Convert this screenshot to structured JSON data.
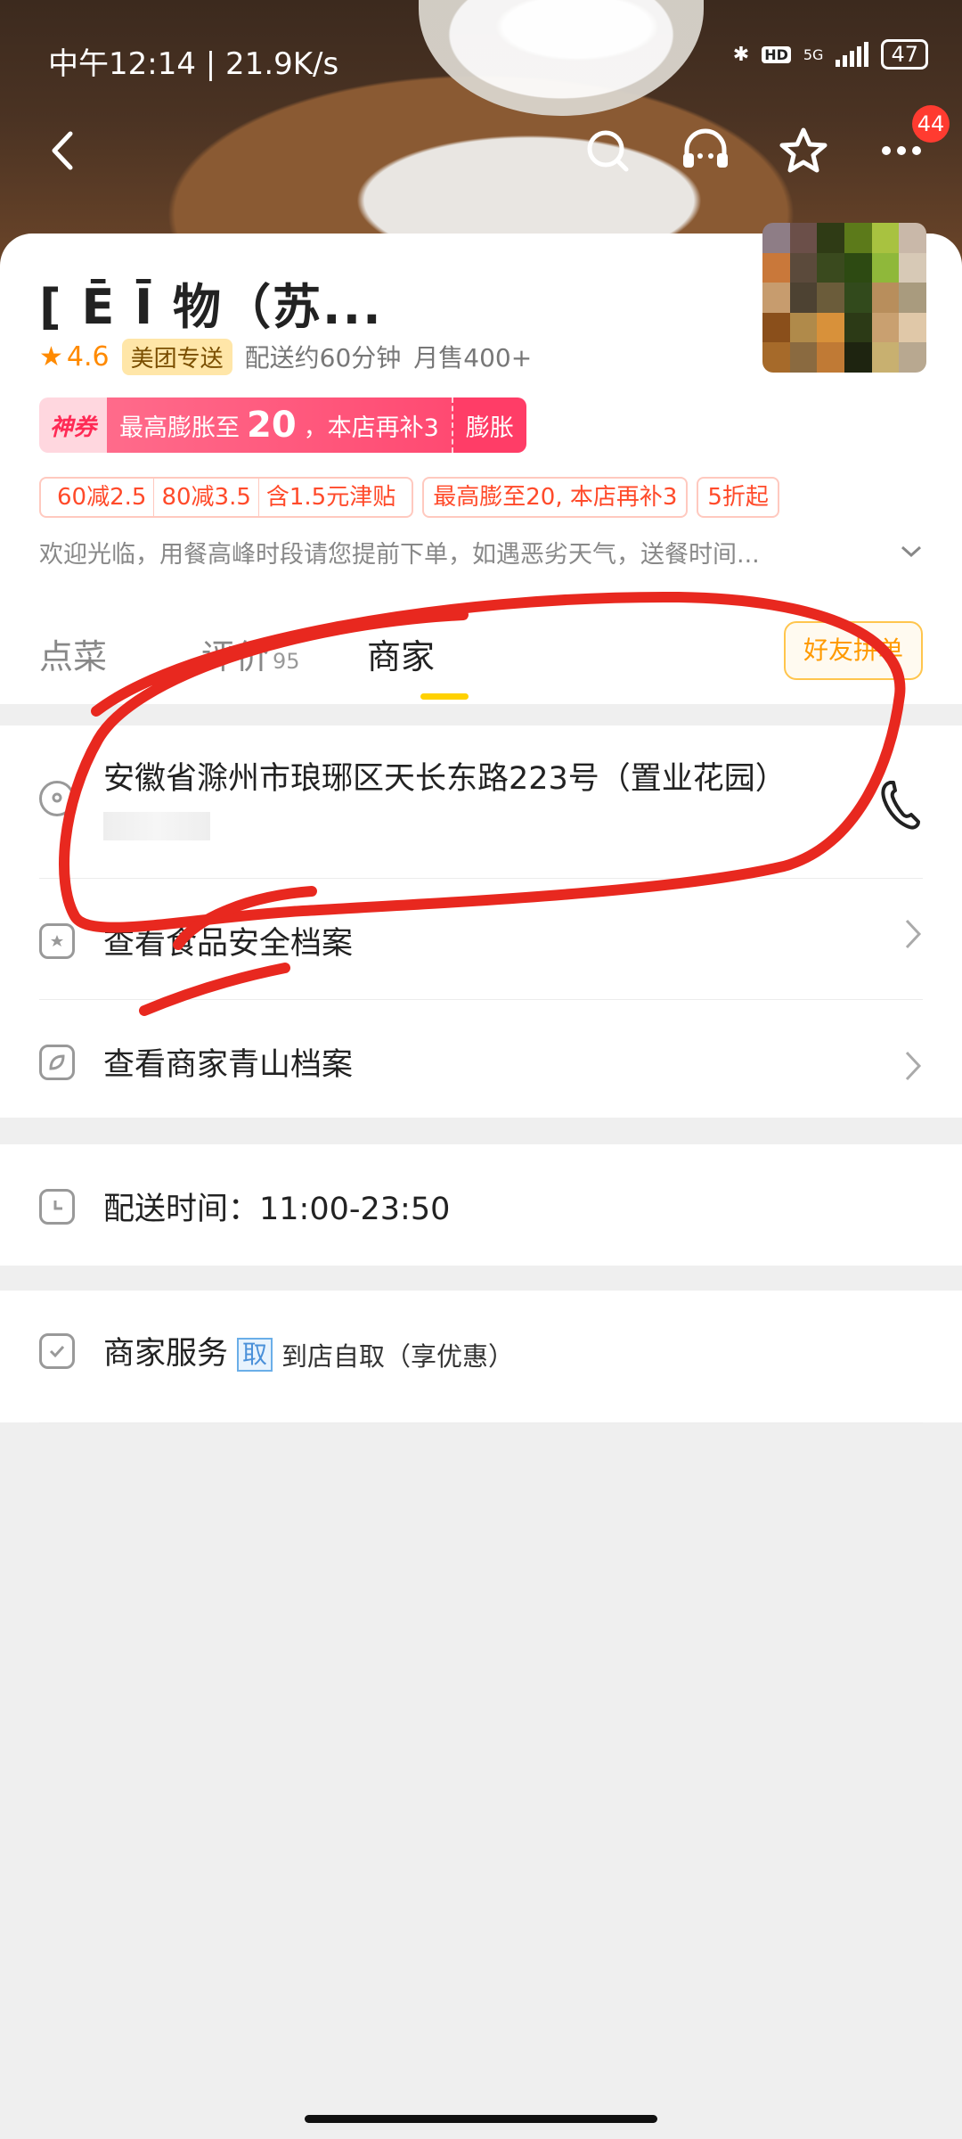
{
  "status_bar": {
    "time": "中午12:14 | 21.9K/s",
    "battery": "47",
    "network": "5G"
  },
  "nav": {
    "back_icon": "back-arrow-icon",
    "badge_count": "44"
  },
  "shop": {
    "title": "[            Ē​  Ī​  物（苏...",
    "rating": "4.6",
    "tag": "美团专送",
    "delivery": "配送约60分钟",
    "monthly_sales": "月售400+"
  },
  "coupon": {
    "label": "神券",
    "text_prefix": "最高膨胀至",
    "amount": "20",
    "text_suffix": "，本店再补3",
    "action": "膨胀"
  },
  "promos": {
    "p1a": "60减2.5",
    "p1b": "80减3.5",
    "p1c": "含1.5元津贴",
    "p2": "最高膨至20, 本店再补3",
    "p3": "5折起"
  },
  "notice": "欢迎光临，用餐高峰时段请您提前下单，如遇恶劣天气，送餐时间...",
  "tabs": {
    "menu": "点菜",
    "reviews": "评价",
    "reviews_count": "95",
    "merchant": "商家",
    "group_order": "好友拼单"
  },
  "merchant": {
    "address": "安徽省滁州市琅琊区天长东路223号（置业花园）",
    "food_safety": "查看食品安全档案",
    "green_archive": "查看商家青山档案",
    "delivery_time": "配送时间：11:00-23:50",
    "service_label": "商家服务",
    "service_tag": "取",
    "service_desc": "到店自取（享优惠）"
  },
  "colors": {
    "accent": "#ffd100",
    "promo": "#ff4a2a",
    "coupon": "#ff4a72",
    "scribble": "#e8281f"
  }
}
